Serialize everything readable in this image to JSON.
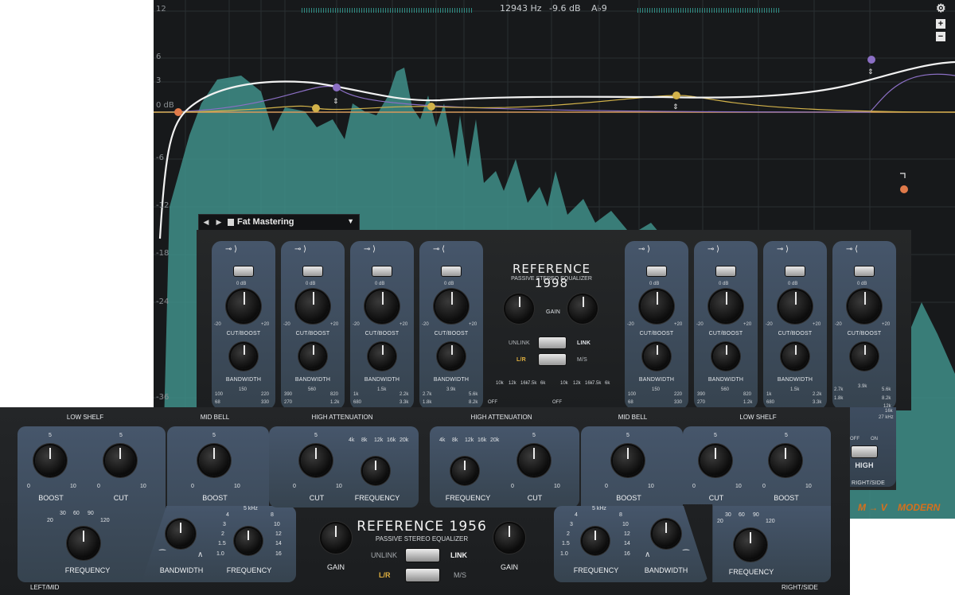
{
  "analyzer": {
    "y_labels": [
      "12",
      "6",
      "3",
      "0 dB",
      "-6",
      "-12",
      "-18",
      "-24",
      "-36"
    ],
    "readout": {
      "frequency": "12943 Hz",
      "gain": "-9.6 dB",
      "note": "A♭9"
    },
    "mode_label": "M → V",
    "style_label": "MODERN",
    "accent_colors": {
      "spectrum": "#3f8f88",
      "curve": "#f2f2f2",
      "node_orange": "#e07a4a",
      "node_yellow": "#d2b24a",
      "node_purple": "#8b6fc4"
    }
  },
  "preset": {
    "name": "Fat Mastering"
  },
  "reference1998": {
    "title": "REFERENCE 1998",
    "subtitle": "PASSIVE STEREO EQUALIZER",
    "gain_label": "GAIN",
    "unlink": "UNLINK",
    "link": "LINK",
    "lr": "L/R",
    "ms": "M/S",
    "cut_boost": "CUT/BOOST",
    "bandwidth": "BANDWIDTH",
    "zero_db": "0 dB",
    "minus20": "-20",
    "plus20": "+20",
    "high_label": "HIGH",
    "off": "OFF",
    "on": "ON",
    "right_side": "RIGHT/SIDE",
    "band_freq_scales": [
      [
        "150",
        "100",
        "220",
        "68",
        "330"
      ],
      [
        "560",
        "390",
        "820",
        "270",
        "1.2k"
      ],
      [
        "1.5k",
        "1k",
        "2.2k",
        "680",
        "3.3k"
      ],
      [
        "3.9k",
        "2.7k",
        "5.6k",
        "1.8k",
        "8.2k"
      ]
    ],
    "high_freqs": [
      "10k",
      "12k",
      "16k",
      "7.5k",
      "6k"
    ],
    "high_right_scale": [
      "3.9k",
      "2.7k",
      "5.6k",
      "1.8k",
      "8.2k",
      "12k",
      "16k",
      "27 kHz"
    ]
  },
  "reference1956": {
    "title": "REFERENCE 1956",
    "subtitle": "PASSIVE STEREO EQUALIZER",
    "sections": [
      "LOW SHELF",
      "MID BELL",
      "HIGH ATTENUATION",
      "HIGH ATTENUATION",
      "MID BELL",
      "LOW SHELF"
    ],
    "boost": "BOOST",
    "cut": "CUT",
    "frequency": "FREQUENCY",
    "bandwidth": "BANDWIDTH",
    "gain": "GAIN",
    "unlink": "UNLINK",
    "link": "LINK",
    "lr": "L/R",
    "ms": "M/S",
    "left_mid": "LEFT/MID",
    "right_side": "RIGHT/SIDE",
    "five": "5",
    "zero": "0",
    "ten": "10",
    "low_freqs": [
      "20",
      "30",
      "60",
      "90",
      "120"
    ],
    "mid_freqs": [
      "5 kHz",
      "4",
      "8",
      "3",
      "10",
      "2",
      "12",
      "1.5",
      "14",
      "1.0",
      "16"
    ],
    "high_freqs": [
      "4k",
      "8k",
      "12k",
      "16k",
      "20k"
    ]
  }
}
